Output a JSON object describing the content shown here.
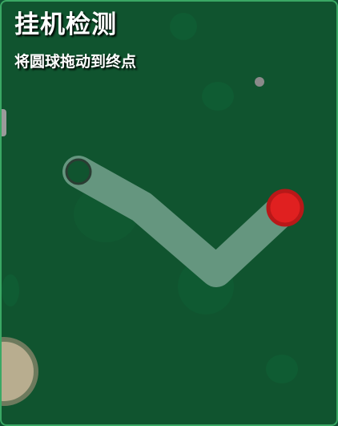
{
  "header": {
    "title": "挂机检测",
    "instruction": "将圆球拖动到终点"
  },
  "colors": {
    "background": "#10542f",
    "frame_border": "#3aa864",
    "path": "#6a9a84",
    "ball": "#e02020",
    "ball_rim": "#b81818",
    "target_ring": "#1a4a30"
  },
  "icons": {
    "ball": "red-ball",
    "target": "goal-ring",
    "dot": "small-gray-dot"
  }
}
